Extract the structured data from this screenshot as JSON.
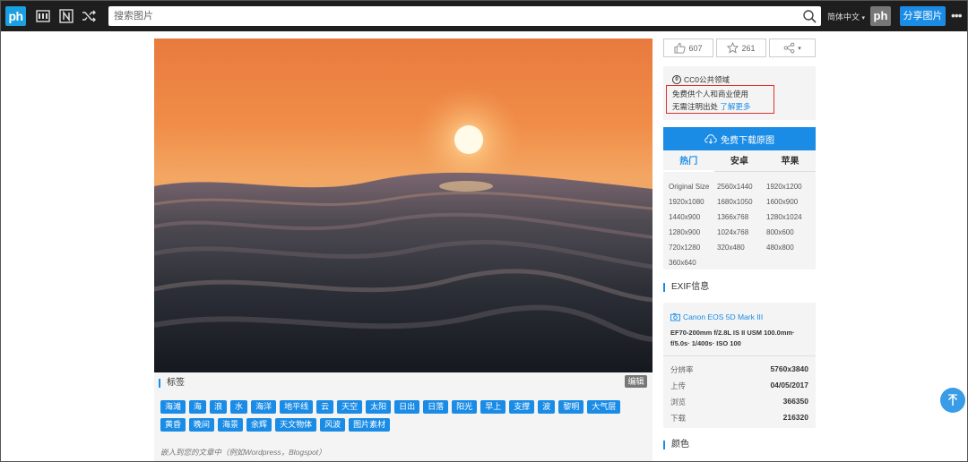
{
  "nav": {
    "logo": "ph",
    "search_placeholder": "搜索图片",
    "language": "简体中文",
    "user_avatar": "ph",
    "share_label": "分享图片",
    "more_label": "•••"
  },
  "stats": {
    "likes": "607",
    "favorites": "261"
  },
  "license": {
    "title": "CC0公共领域",
    "line1": "免费供个人和商业使用",
    "line2_prefix": "无需注明出处",
    "line2_link": "了解更多"
  },
  "download": {
    "button_label": "免费下载原图",
    "tabs": [
      "热门",
      "安卓",
      "苹果"
    ],
    "active_tab": "热门",
    "sizes": [
      "Original Size",
      "2560x1440",
      "1920x1200",
      "1920x1080",
      "1680x1050",
      "1600x900",
      "1440x900",
      "1366x768",
      "1280x1024",
      "1280x900",
      "1024x768",
      "800x600",
      "720x1280",
      "320x480",
      "480x800",
      "360x640"
    ]
  },
  "exif": {
    "title": "EXIF信息",
    "camera": "Canon EOS 5D Mark III",
    "lens": "EF70-200mm f/2.8L IS II USM 100.0mm· f/5.0s· 1/400s· ISO 100",
    "rows": [
      {
        "key": "分辨率",
        "value": "5760x3840"
      },
      {
        "key": "上传",
        "value": "04/05/2017"
      },
      {
        "key": "浏览",
        "value": "366350"
      },
      {
        "key": "下载",
        "value": "216320"
      }
    ]
  },
  "colors_title": "颜色",
  "tags": {
    "title": "标签",
    "edit_label": "编辑",
    "items": [
      "海滩",
      "海",
      "浪",
      "水",
      "海洋",
      "地平线",
      "云",
      "天空",
      "太阳",
      "日出",
      "日落",
      "阳光",
      "早上",
      "支撑",
      "波",
      "黎明",
      "大气层",
      "黄昏",
      "晚间",
      "海景",
      "余辉",
      "天文物体",
      "风波",
      "图片素材"
    ],
    "embed_hint": "嵌入到您的文章中（例如Wordpress，Blogspot）"
  },
  "theme": {
    "accent": "#1a8ce6",
    "topbar": "#1e1e1e",
    "highlight_box": "#e03030"
  }
}
